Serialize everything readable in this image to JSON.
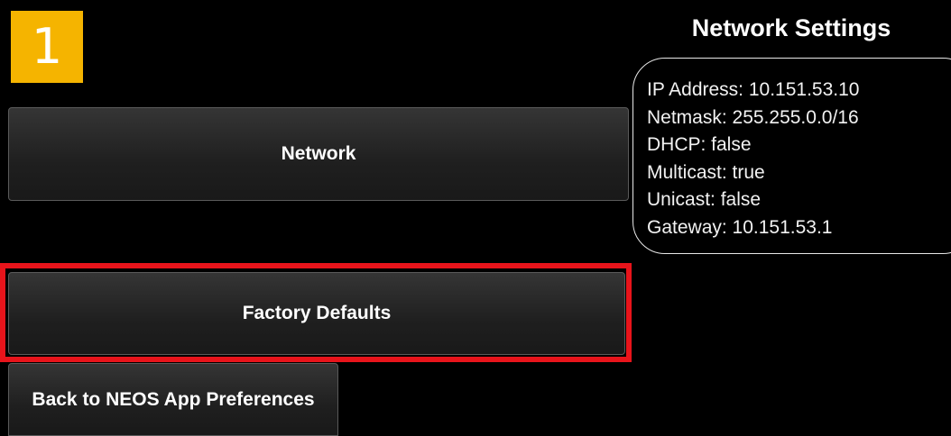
{
  "step_badge": {
    "number": "1",
    "color": "#f5b400"
  },
  "buttons": {
    "network": "Network",
    "factory_defaults": "Factory Defaults",
    "back": "Back to NEOS App Preferences"
  },
  "highlight": {
    "color": "#e8141b",
    "target": "factory_defaults"
  },
  "network_settings": {
    "title": "Network Settings",
    "lines": [
      "IP Address: 10.151.53.10",
      "Netmask: 255.255.0.0/16",
      "DHCP: false",
      "Multicast: true",
      "Unicast: false",
      "Gateway: 10.151.53.1"
    ]
  }
}
